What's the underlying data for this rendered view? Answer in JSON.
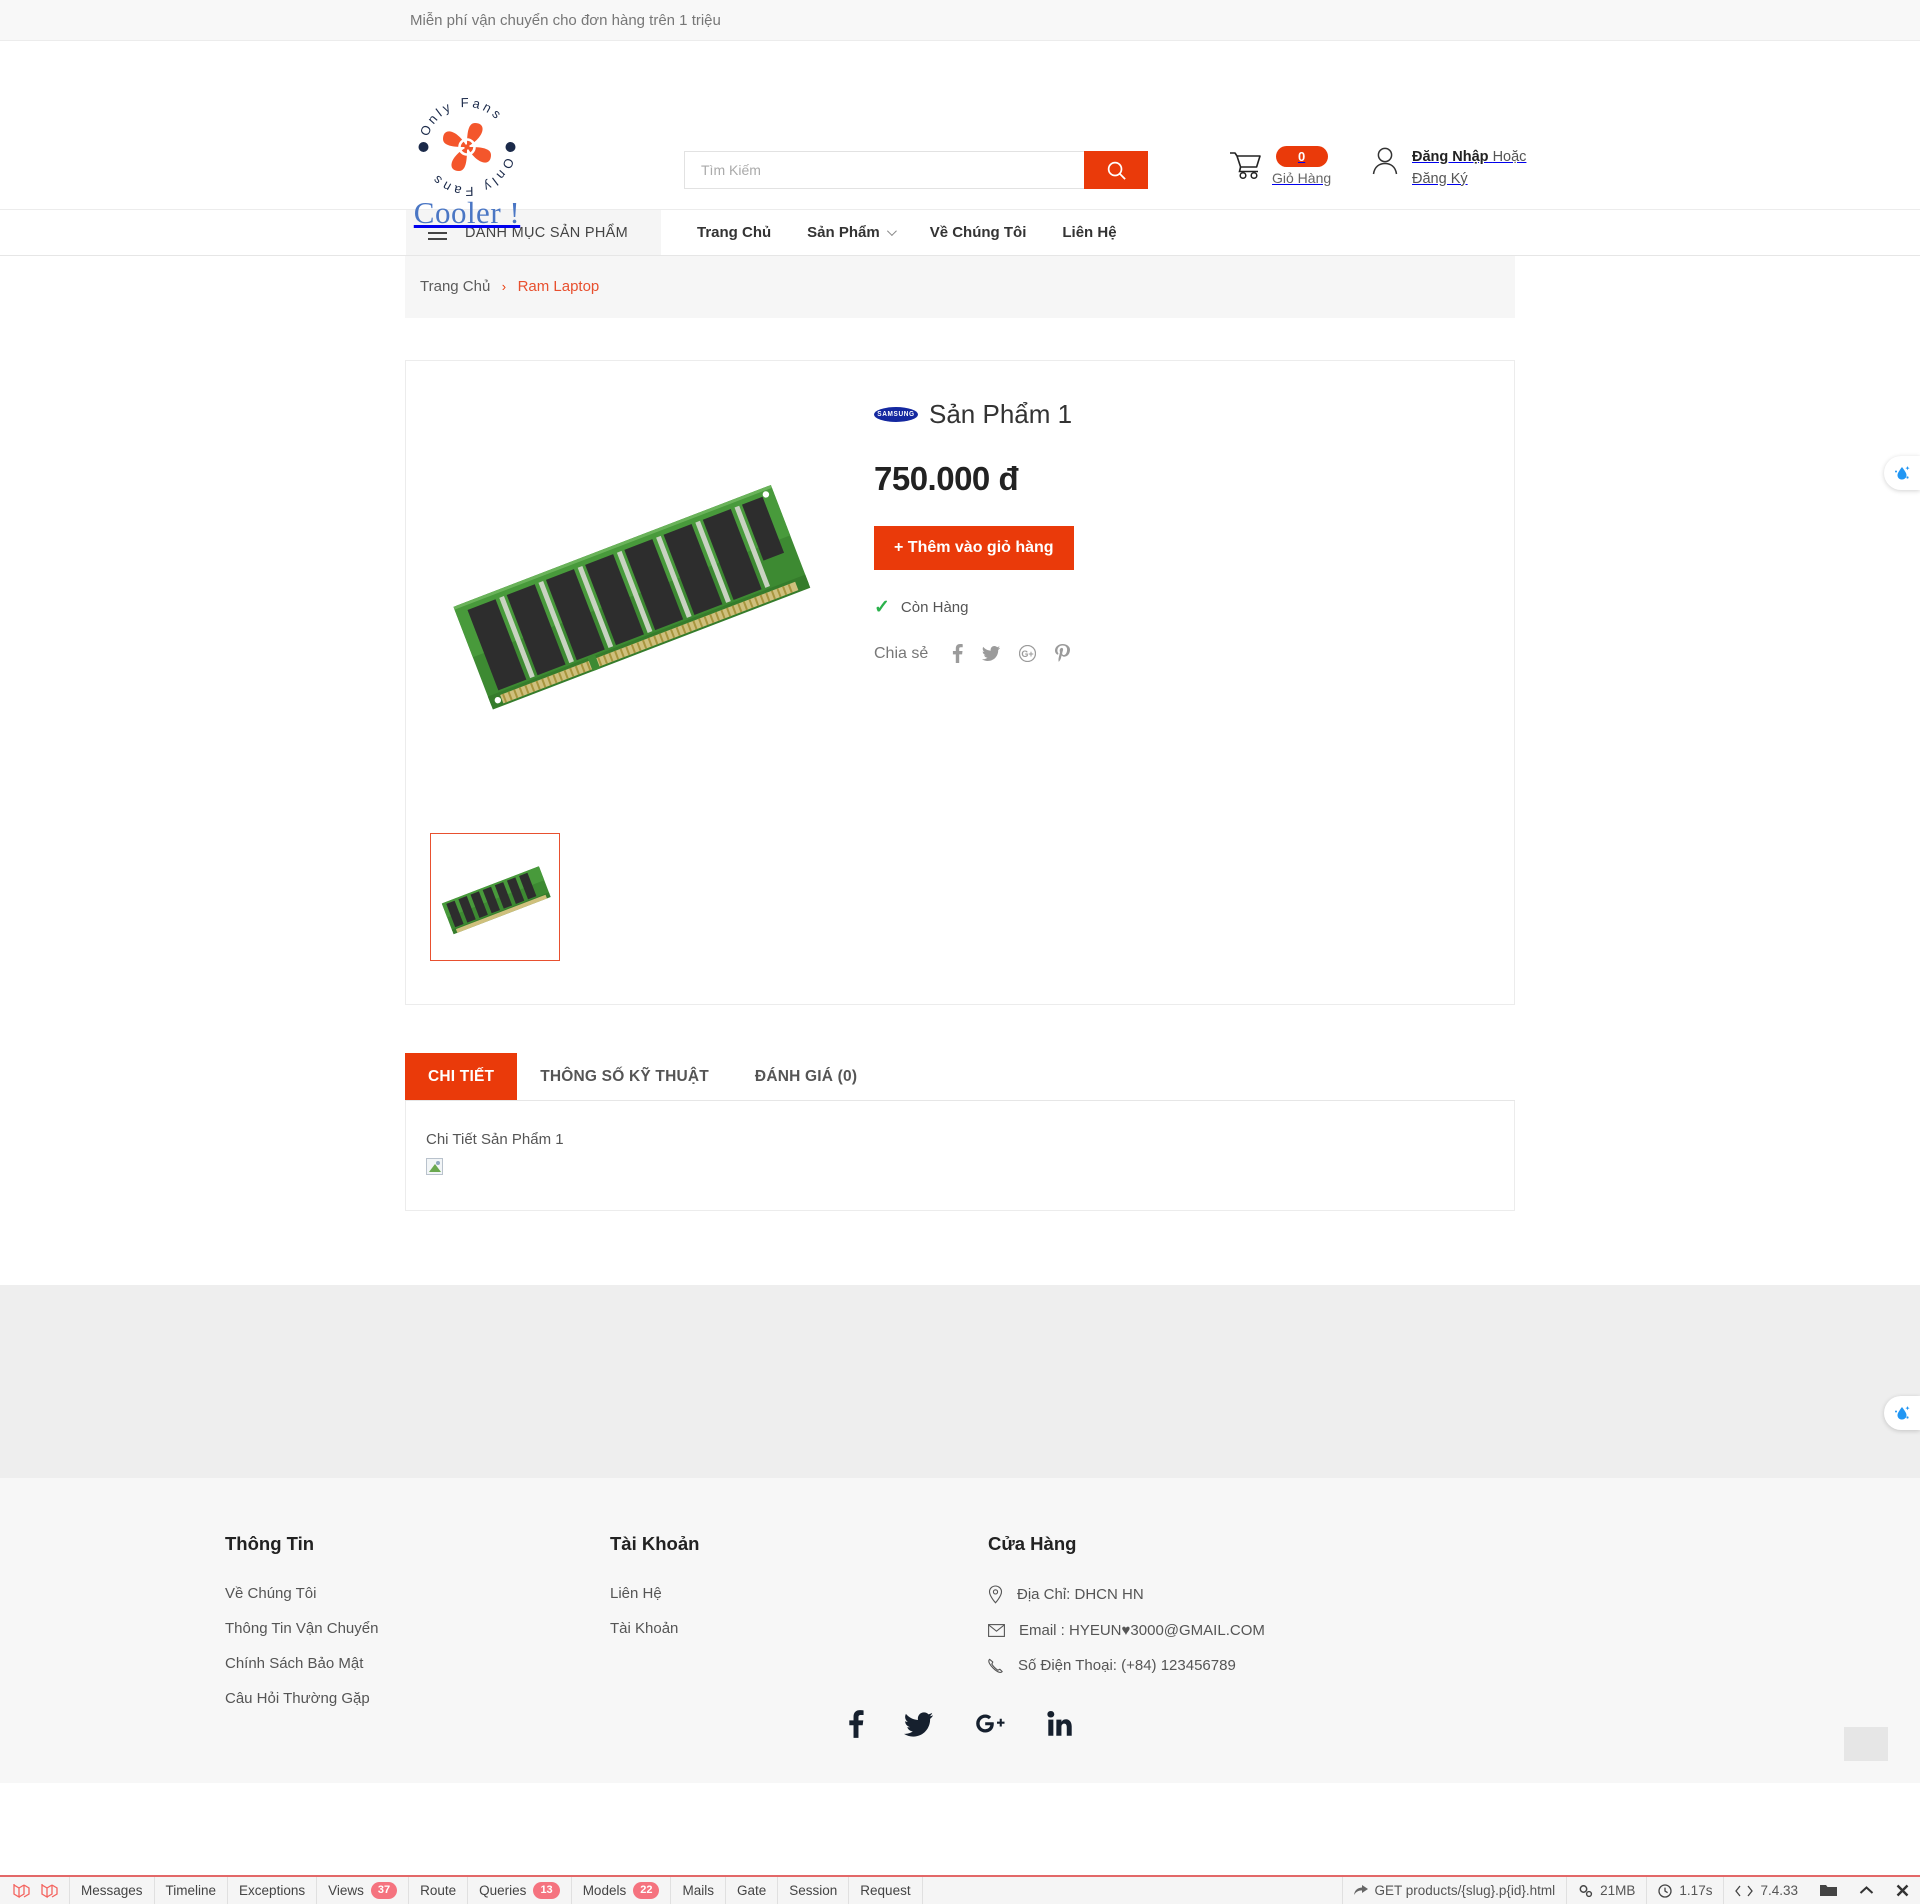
{
  "topbar": {
    "message": "Miễn phí vận chuyển cho đơn hàng trên 1 triệu"
  },
  "header": {
    "logo_text": "Cooler !",
    "logo_ring_text": "Only Fans",
    "search": {
      "placeholder": "Tìm Kiếm",
      "value": "",
      "icon": "search-icon"
    },
    "cart": {
      "count": "0",
      "label": "Giỏ Hàng",
      "icon": "cart-icon"
    },
    "account": {
      "icon": "user-icon",
      "login": "Đăng Nhập",
      "or": "Hoặc",
      "register": "Đăng Ký"
    }
  },
  "nav": {
    "categories_label": "DANH MỤC SẢN PHẨM",
    "links": [
      {
        "label": "Trang Chủ",
        "has_chevron": false
      },
      {
        "label": "Sản Phẩm",
        "has_chevron": true
      },
      {
        "label": "Về Chúng Tôi",
        "has_chevron": false
      },
      {
        "label": "Liên Hệ",
        "has_chevron": false
      }
    ]
  },
  "breadcrumb": {
    "home": "Trang Chủ",
    "separator": "›",
    "current": "Ram Laptop"
  },
  "product": {
    "brand_logo_text": "SAMSUNG",
    "title": "Sản Phẩm 1",
    "price": "750.000 đ",
    "add_to_cart": "+ Thêm vào giỏ hàng",
    "stock_check": "✓",
    "stock_label": "Còn Hàng",
    "share_label": "Chia sẻ",
    "share_links": [
      "facebook-icon",
      "twitter-icon",
      "google-plus-icon",
      "pinterest-icon"
    ],
    "gallery_alt": "ram-module-image",
    "thumbnail_alt": "ram-module-thumbnail"
  },
  "tabs": {
    "items": [
      {
        "label": "CHI TIẾT",
        "active": true
      },
      {
        "label": "THÔNG SỐ KỸ THUẬT",
        "active": false
      },
      {
        "label": "ĐÁNH GIÁ (0)",
        "active": false
      }
    ],
    "content": "Chi Tiết Sản Phẩm 1"
  },
  "footer": {
    "columns": [
      {
        "title": "Thông Tin",
        "links": [
          "Về Chúng Tôi",
          "Thông Tin Vận Chuyển",
          "Chính Sách Bảo Mật",
          "Câu Hỏi Thường Gặp"
        ]
      },
      {
        "title": "Tài Khoản",
        "links": [
          "Liên Hệ",
          "Tài Khoản"
        ]
      }
    ],
    "store": {
      "title": "Cửa Hàng",
      "address": "Địa Chỉ: DHCN HN",
      "email": "Email : HYEUN♥3000@GMAIL.COM",
      "phone": "Số Điện Thoại: (+84) 123456789"
    },
    "social": [
      "facebook-icon",
      "twitter-icon",
      "google-plus-icon",
      "linkedin-icon"
    ]
  },
  "debugbar": {
    "items": [
      {
        "label": "Messages",
        "badge": ""
      },
      {
        "label": "Timeline",
        "badge": ""
      },
      {
        "label": "Exceptions",
        "badge": ""
      },
      {
        "label": "Views",
        "badge": "37"
      },
      {
        "label": "Route",
        "badge": ""
      },
      {
        "label": "Queries",
        "badge": "13"
      },
      {
        "label": "Models",
        "badge": "22"
      },
      {
        "label": "Mails",
        "badge": ""
      },
      {
        "label": "Gate",
        "badge": ""
      },
      {
        "label": "Session",
        "badge": ""
      },
      {
        "label": "Request",
        "badge": ""
      }
    ],
    "route": "GET products/{slug}.p{id}.html",
    "memory": "21MB",
    "time": "1.17s",
    "php_version": "7.4.33"
  },
  "colors": {
    "accent": "#ea3a0a",
    "brand_blue": "#1428a0",
    "logo_blue": "#4a76c4",
    "stock_green": "#2bb24c"
  }
}
